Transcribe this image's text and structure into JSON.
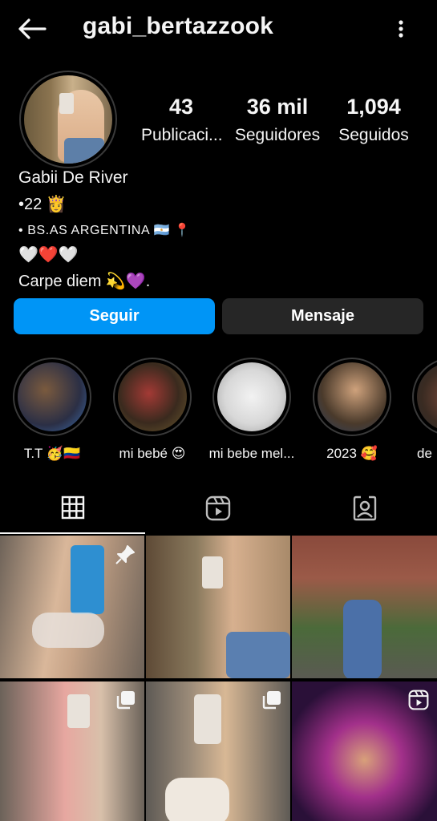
{
  "header": {
    "username": "gabi_bertazzook",
    "back_icon": "arrow-left-icon",
    "more_icon": "more-vertical-icon"
  },
  "stats": [
    {
      "value": "43",
      "label": "Publicaci..."
    },
    {
      "value": "36 mil",
      "label": "Seguidores"
    },
    {
      "value": "1,094",
      "label": "Seguidos"
    }
  ],
  "bio": {
    "name": "Gabii De River",
    "line1": "•22 👸",
    "line2": "• BS.AS ARGENTINA 🇦🇷 📍",
    "line3": "🤍❤️🤍",
    "line4": "Carpe diem 💫💜."
  },
  "buttons": {
    "follow": "Seguir",
    "message": "Mensaje"
  },
  "highlights": [
    {
      "label": "T.T 🥳🇨🇴",
      "colors": [
        "#2b2f45",
        "#7a5a3e",
        "#3d6fb0"
      ]
    },
    {
      "label": "mi bebé 😍",
      "colors": [
        "#3a2a1e",
        "#a33a35",
        "#6b5a2e"
      ]
    },
    {
      "label": "mi bebe mel...",
      "colors": [
        "#d8d8d8",
        "#f2f2f2",
        "#bdbdbd"
      ]
    },
    {
      "label": "2023 🥰",
      "colors": [
        "#4a3a2b",
        "#cfa27c",
        "#2d3e5c"
      ]
    },
    {
      "label": "de",
      "colors": [
        "#3a2b22",
        "#7a4a3a",
        "#2a2a2a"
      ]
    }
  ],
  "tabs": [
    {
      "name": "grid",
      "icon": "grid-icon",
      "active": true
    },
    {
      "name": "reels",
      "icon": "reels-icon",
      "active": false
    },
    {
      "name": "tagged",
      "icon": "tagged-user-icon",
      "active": false
    }
  ],
  "posts": [
    {
      "badge": "pin-icon",
      "colors": [
        "#6d6258",
        "#d9b79a",
        "#2e8fd1"
      ]
    },
    {
      "badge": "",
      "colors": [
        "#5e4a36",
        "#d7b08f",
        "#5a7fb0"
      ]
    },
    {
      "badge": "",
      "colors": [
        "#8a4a3c",
        "#4b6a3a",
        "#4b70a8"
      ]
    },
    {
      "badge": "multi-photo-icon",
      "colors": [
        "#6b6259",
        "#e7a7a0",
        "#d8c0aa"
      ]
    },
    {
      "badge": "multi-photo-icon",
      "colors": [
        "#5e5a55",
        "#d8b895",
        "#efe8df"
      ]
    },
    {
      "badge": "reel-icon",
      "colors": [
        "#2a1038",
        "#a2308a",
        "#d8a07a"
      ]
    }
  ],
  "accent": "#0095f6"
}
